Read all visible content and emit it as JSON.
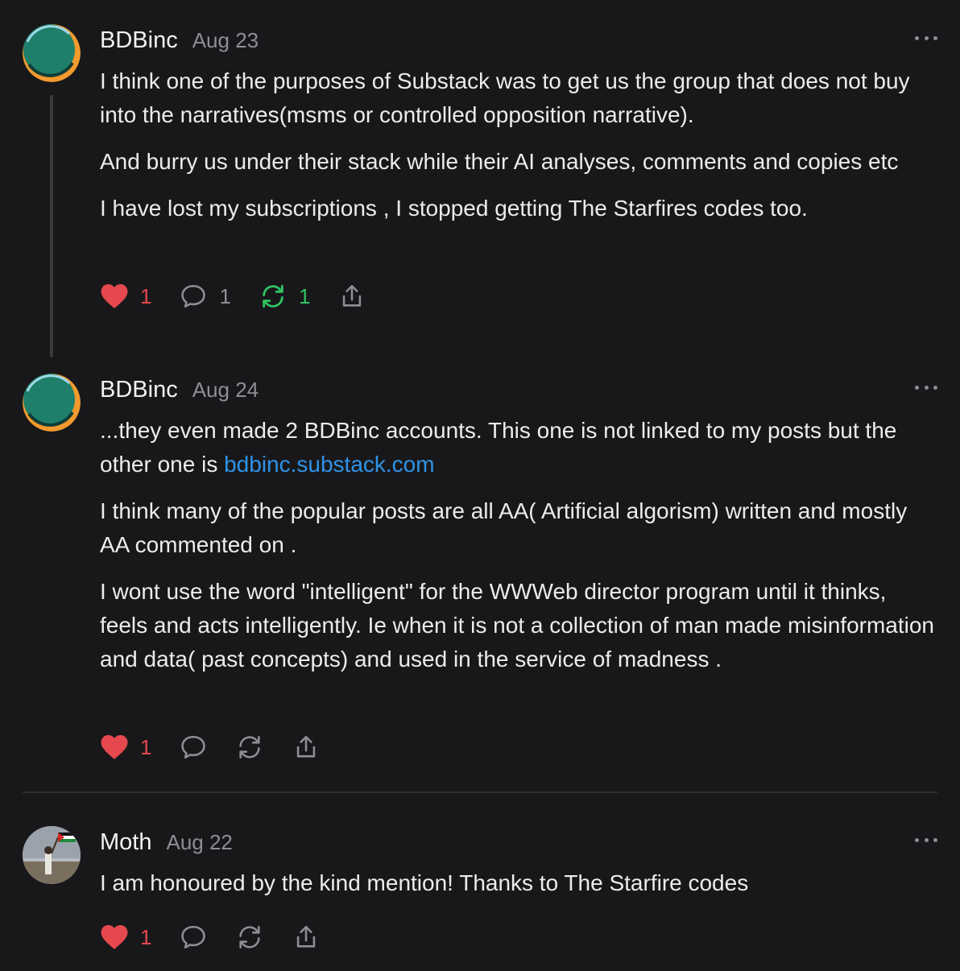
{
  "comments": [
    {
      "author": "BDBinc",
      "date": "Aug 23",
      "paragraphs": [
        "I think one of the purposes of Substack was to get us the group that does not buy into the narratives(msms or controlled opposition narrative).",
        "And burry us under their stack while their AI analyses, comments and copies etc",
        "I have lost my subscriptions , I stopped getting The Starfires codes too."
      ],
      "likes": "1",
      "replies": "1",
      "restacks": "1"
    },
    {
      "author": "BDBinc",
      "date": "Aug 24",
      "p1_text": "...they even made 2 BDBinc accounts. This one is not linked to my posts but the other one is ",
      "p1_link": "bdbinc.substack.com",
      "paragraphs": [
        "I think many of the popular posts are all AA( Artificial algorism) written and mostly AA commented on .",
        "I wont use the word \"intelligent\" for the WWWeb director program until it thinks, feels and acts intelligently. Ie when it is not a collection of man made misinformation and data( past concepts) and used in the service of madness ."
      ],
      "likes": "1"
    },
    {
      "author": "Moth",
      "date": "Aug 22",
      "paragraphs": [
        "I am honoured by the kind mention! Thanks to The Starfire codes"
      ],
      "likes": "1"
    }
  ],
  "icons": {
    "like": "heart-icon",
    "reply": "comment-bubble-icon",
    "restack": "restack-icon",
    "share": "share-icon",
    "more": "more-horizontal-icon"
  },
  "colors": {
    "background": "#18181a",
    "like": "#e5484d",
    "restack_active": "#30c463",
    "link": "#2f93e8",
    "muted": "#8e8e93"
  }
}
